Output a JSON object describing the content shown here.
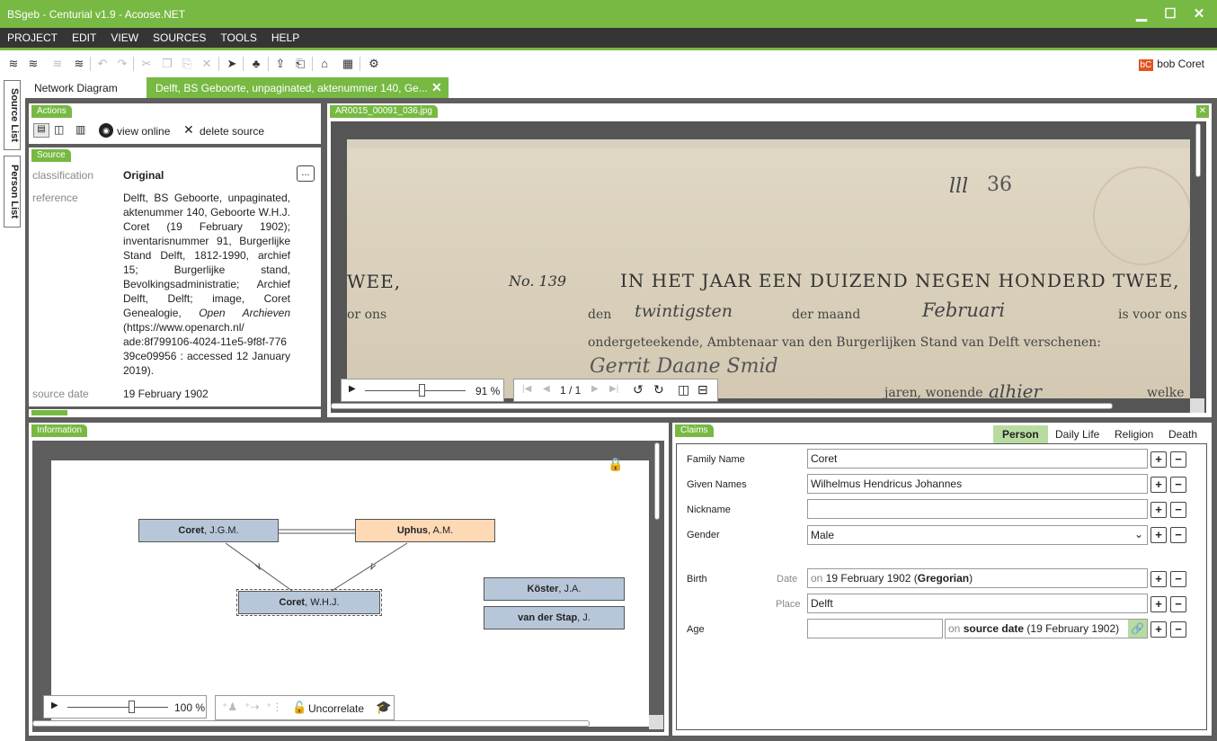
{
  "window": {
    "title": "BSgeb - Centurial v1.9 - Acoose.NET",
    "min": "▁",
    "max": "☐",
    "close": "✕"
  },
  "menu": [
    "PROJECT",
    "EDIT",
    "VIEW",
    "SOURCES",
    "TOOLS",
    "HELP"
  ],
  "user": {
    "initials": "bC",
    "name": "bob Coret"
  },
  "tabs": [
    {
      "label": "Network Diagram"
    },
    {
      "label": "Delft, BS Geboorte, unpaginated, aktenummer 140, Ge..."
    }
  ],
  "sidebar": [
    "Source List",
    "Person List"
  ],
  "actions": {
    "label": "Actions",
    "view_online": "view online",
    "delete_source": "delete source"
  },
  "source": {
    "label": "Source",
    "classification_key": "classification",
    "classification": "Original",
    "reference_key": "reference",
    "reference_pre": "Delft, BS Geboorte, unpaginated, aktenummer 140, Geboorte W.H.J. Coret (19 February 1902); inventarisnummer 91, Burgerlijke Stand Delft, 1812-1990, archief 15; Burgerlijke stand, Bevolkingsadministratie; Archief Delft, Delft; image, Coret Genealogie,",
    "reference_ital": "Open Archieven",
    "reference_post": "(https://www.openarch.nl/ ade:8f799106-4024-11e5-9f8f-776 39ce09956 : accessed 12 January 2019).",
    "date_key": "source date",
    "date": "19 February 1902",
    "more_btn": "..."
  },
  "image": {
    "label": "AR0015_00091_036.jpg",
    "zoom": "91 %",
    "page": "1 / 1",
    "doc_number": "36",
    "doc_line1": "IN HET JAAR EEN DUIZEND NEGEN HONDERD TWEE,",
    "doc_no": "No. 139",
    "doc_left": "WEE,",
    "doc_left2": "or ons",
    "doc_line2a": "den",
    "doc_line2b": "twintigsten",
    "doc_line2c": "der maand",
    "doc_line2d": "Februari",
    "doc_line2e": "is voor ons",
    "doc_line3": "ondergeteekende, Ambtenaar van den Burgerlijken Stand van Delft verschenen:",
    "doc_line4": "Gerrit Daane Smid",
    "doc_line5a": "jaren, wonende",
    "doc_line5b": "alhier",
    "doc_line5c": "welke"
  },
  "information": {
    "label": "Information",
    "zoom": "100 %",
    "uncorrelate": "Uncorrelate",
    "nodes": [
      {
        "bold": "Coret",
        "rest": ", J.G.M."
      },
      {
        "bold": "Uphus",
        "rest": ", A.M."
      },
      {
        "bold": "Coret",
        "rest": ", W.H.J."
      },
      {
        "bold": "Köster",
        "rest": ", J.A."
      },
      {
        "bold": "van der Stap",
        "rest": ", J."
      }
    ]
  },
  "claims": {
    "label": "Claims",
    "tabs": [
      "Person",
      "Daily Life",
      "Religion",
      "Death"
    ],
    "family_name_label": "Family Name",
    "family_name": "Coret",
    "given_names_label": "Given Names",
    "given_names": "Wilhelmus Hendricus Johannes",
    "nickname_label": "Nickname",
    "nickname": "",
    "gender_label": "Gender",
    "gender": "Male",
    "birth_label": "Birth",
    "date_label": "Date",
    "birth_date_pre": "on",
    "birth_date": "19 February 1902",
    "birth_calendar": "Gregorian",
    "place_label": "Place",
    "birth_place": "Delft",
    "age_label": "Age",
    "age": "",
    "age_ref_pre": "on",
    "age_ref_bold": "source date",
    "age_ref_date": "(19 February 1902)"
  },
  "colors": {
    "accent": "#77b943",
    "dark": "#353535",
    "panel_bg": "#5e5e5e"
  }
}
